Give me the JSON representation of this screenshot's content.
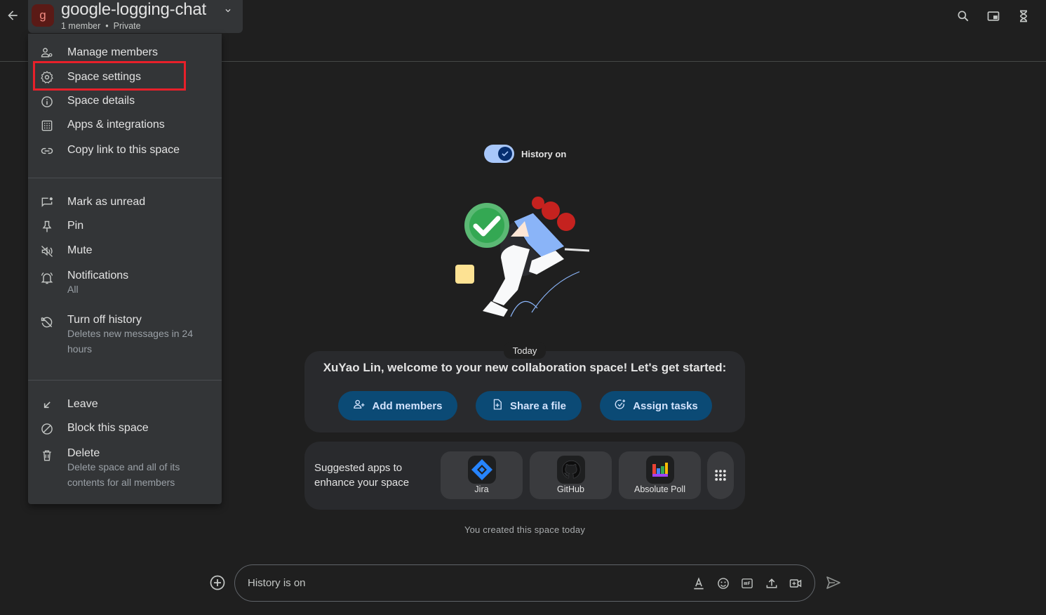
{
  "header": {
    "avatar_letter": "g",
    "space_title": "google-logging-chat",
    "member_count": "1 member",
    "separator": "•",
    "privacy": "Private",
    "icons": [
      "back-arrow-icon",
      "chevron-down-icon",
      "search-icon",
      "picture-in-picture-icon",
      "hourglass-icon"
    ]
  },
  "menu": {
    "items": [
      {
        "label": "Manage members",
        "icon": "manage-members-icon"
      },
      {
        "label": "Space settings",
        "icon": "gear-icon",
        "highlighted": true
      },
      {
        "label": "Space details",
        "icon": "info-icon"
      },
      {
        "label": "Apps & integrations",
        "icon": "apps-grid-icon"
      },
      {
        "label": "Copy link to this space",
        "icon": "link-icon"
      },
      {
        "label": "Mark as unread",
        "icon": "mark-unread-icon"
      },
      {
        "label": "Pin",
        "icon": "pin-icon"
      },
      {
        "label": "Mute",
        "icon": "mute-icon"
      },
      {
        "label": "Notifications",
        "sub": "All",
        "icon": "bell-icon"
      },
      {
        "label": "Turn off history",
        "sub": "Deletes new messages in 24 hours",
        "icon": "history-off-icon"
      },
      {
        "label": "Leave",
        "icon": "leave-arrow-icon"
      },
      {
        "label": "Block this space",
        "icon": "block-icon"
      },
      {
        "label": "Delete",
        "sub": "Delete space and all of its contents for all members",
        "icon": "trash-icon"
      }
    ]
  },
  "history_toggle": {
    "label": "History on",
    "state": "on"
  },
  "welcome": {
    "date_chip": "Today",
    "message": "XuYao Lin, welcome to your new collaboration space! Let's get started:",
    "buttons": [
      {
        "label": "Add members",
        "icon": "add-person-icon"
      },
      {
        "label": "Share a file",
        "icon": "add-file-icon"
      },
      {
        "label": "Assign tasks",
        "icon": "add-task-icon"
      }
    ]
  },
  "suggested_apps": {
    "text": "Suggested apps to enhance your space",
    "apps": [
      {
        "name": "Jira",
        "icon": "jira-logo-icon"
      },
      {
        "name": "GitHub",
        "icon": "github-logo-icon"
      },
      {
        "name": "Absolute Poll",
        "icon": "absolute-poll-logo-icon"
      }
    ],
    "more_icon": "apps-dots-icon"
  },
  "created_text": "You created this space today",
  "composer": {
    "placeholder": "History is on",
    "icons": [
      "add-circle-icon",
      "text-format-icon",
      "emoji-icon",
      "gif-icon",
      "upload-icon",
      "video-meeting-icon",
      "send-icon"
    ]
  },
  "colors": {
    "background": "#1f1f1f",
    "menu_bg": "#333537",
    "card_bg": "#292a2d",
    "button_bg": "#0b4a75",
    "button_text": "#d3e3fd",
    "highlight_border": "#e8202a",
    "toggle_track": "#a8c7fa"
  }
}
